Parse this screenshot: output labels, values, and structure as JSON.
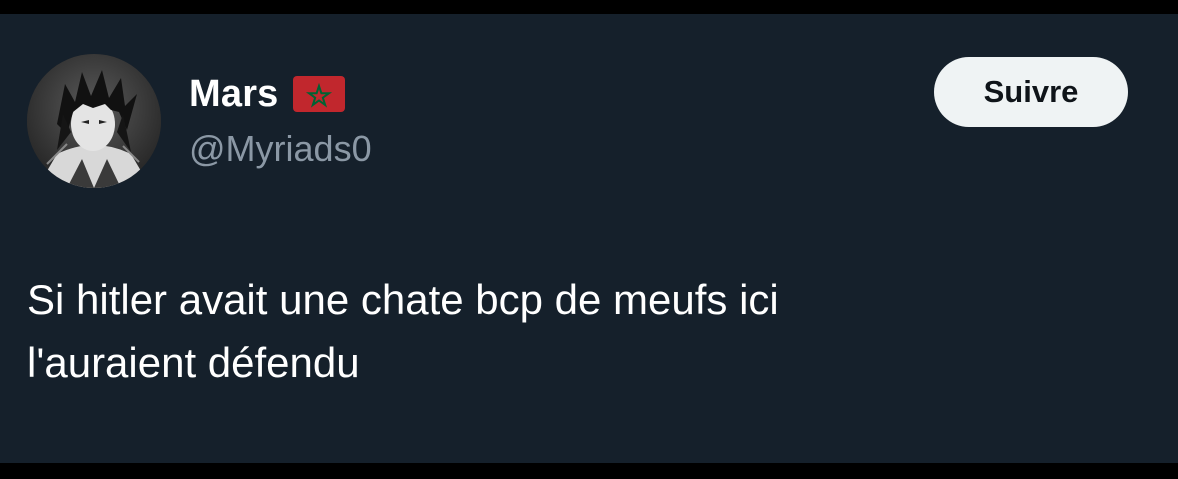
{
  "tweet": {
    "author": {
      "display_name": "Mars",
      "flag_icon": "morocco-flag-icon",
      "handle": "@Myriads0",
      "avatar_icon": "anime-character-avatar"
    },
    "follow_label": "Suivre",
    "text": "Si hitler avait une chate bcp de meufs ici\nl'auraient défendu"
  },
  "colors": {
    "background": "#15202b",
    "outer_frame": "#000000",
    "text_primary": "#ffffff",
    "text_secondary": "#8b98a5",
    "button_bg": "#eff3f4",
    "button_text": "#0f1419",
    "flag_red": "#c1272d",
    "flag_green": "#006233"
  }
}
